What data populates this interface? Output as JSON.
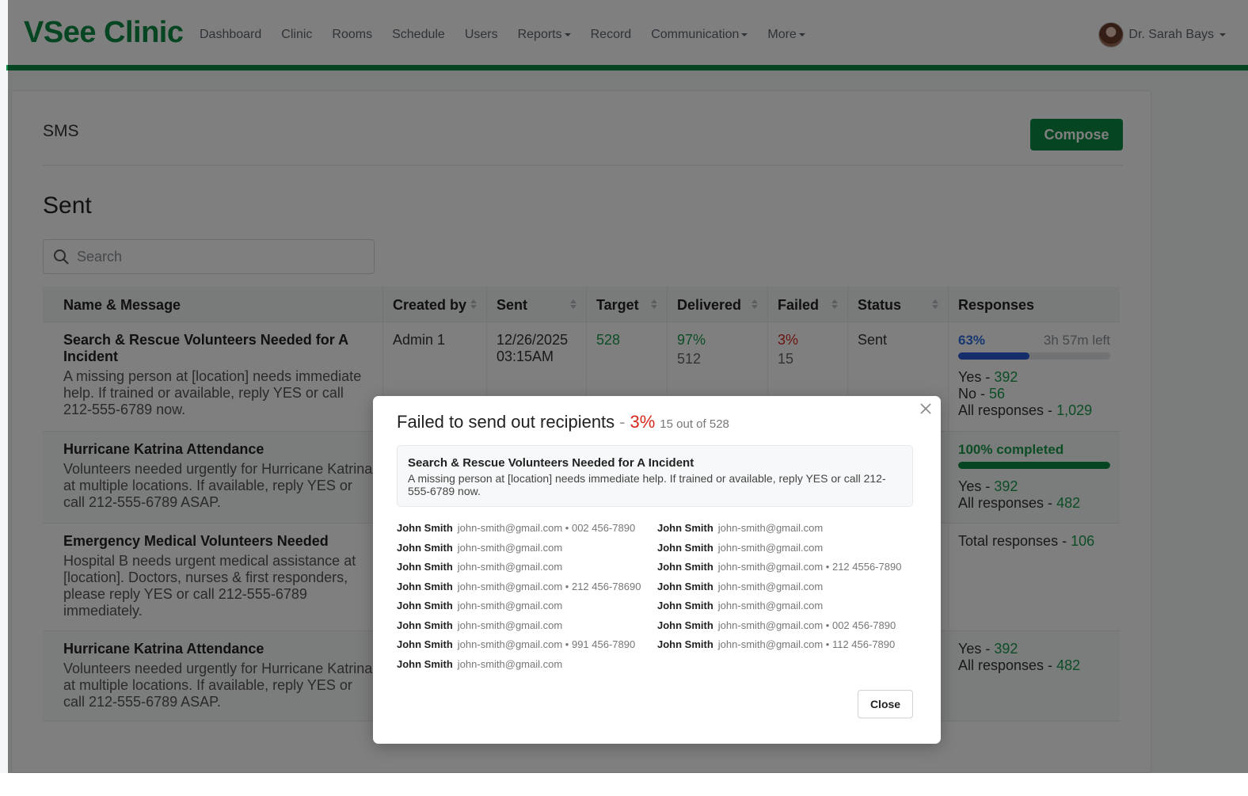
{
  "app": {
    "logo": "VSee Clinic"
  },
  "nav": {
    "items": [
      {
        "label": "Dashboard",
        "dropdown": false
      },
      {
        "label": "Clinic",
        "dropdown": false
      },
      {
        "label": "Rooms",
        "dropdown": false
      },
      {
        "label": "Schedule",
        "dropdown": false
      },
      {
        "label": "Users",
        "dropdown": false
      },
      {
        "label": "Reports",
        "dropdown": true
      },
      {
        "label": "Record",
        "dropdown": false
      },
      {
        "label": "Communication",
        "dropdown": true
      },
      {
        "label": "More",
        "dropdown": true
      }
    ],
    "user": "Dr. Sarah Bays"
  },
  "page": {
    "section_title": "SMS",
    "compose_label": "Compose",
    "list_title": "Sent",
    "search_placeholder": "Search"
  },
  "table": {
    "headers": [
      "Name & Message",
      "Created by",
      "Sent",
      "Target",
      "Delivered",
      "Failed",
      "Status",
      "Responses"
    ],
    "rows": [
      {
        "title": "Search & Rescue Volunteers Needed for A Incident",
        "body": "A missing person at [location] needs immediate help. If trained or available, reply YES or call 212-555-6789 now.",
        "created_by": "Admin 1",
        "sent_date": "12/26/2025",
        "sent_time": "03:15AM",
        "target": "528",
        "delivered_pct": "97%",
        "delivered_count": "512",
        "failed_pct": "3%",
        "failed_count": "15",
        "status": "Sent",
        "resp_pct": "63%",
        "resp_progress": 0.47,
        "resp_left": "3h 57m left",
        "yes_label": "Yes - ",
        "yes": "392",
        "no_label": "No - ",
        "no": "56",
        "all_label": "All responses - ",
        "all": "1,029"
      },
      {
        "title": "Hurricane Katrina Attendance",
        "body": "Volunteers needed urgently for Hurricane Katrina at multiple locations. If available, reply YES or call 212-555-6789 ASAP.",
        "resp_completed": "100% completed",
        "resp_progress": 1.0,
        "yes_label": "Yes - ",
        "yes": "392",
        "all_label": "All responses - ",
        "all": "482"
      },
      {
        "title": "Emergency Medical Volunteers Needed",
        "body": "Hospital B needs urgent medical assistance at [location]. Doctors, nurses & first responders, please reply YES or call 212-555-6789 immediately.",
        "total_label": "Total responses - ",
        "total": "106"
      },
      {
        "title": "Hurricane Katrina Attendance",
        "body": "Volunteers needed urgently for Hurricane Katrina at multiple locations. If available, reply YES or call 212-555-6789 ASAP.",
        "yes_label": "Yes - ",
        "yes": "392",
        "all_label": "All responses - ",
        "all": "482"
      }
    ]
  },
  "modal": {
    "title": "Failed to send out recipients",
    "dash": "-",
    "pct": "3%",
    "count": "15 out of 528",
    "message_title": "Search & Rescue Volunteers Needed for A Incident",
    "message_body": "A missing person at [location] needs immediate help. If trained or available, reply YES or call 212-555-6789 now.",
    "close_label": "Close",
    "recipients_left": [
      {
        "name": "John Smith",
        "email": "john-smith@gmail.com",
        "phone": " • 002 456-7890"
      },
      {
        "name": "John Smith",
        "email": "john-smith@gmail.com",
        "phone": ""
      },
      {
        "name": "John Smith",
        "email": "john-smith@gmail.com",
        "phone": ""
      },
      {
        "name": "John Smith",
        "email": "john-smith@gmail.com",
        "phone": " • 212 456-78690"
      },
      {
        "name": "John Smith",
        "email": "john-smith@gmail.com",
        "phone": ""
      },
      {
        "name": "John Smith",
        "email": "john-smith@gmail.com",
        "phone": ""
      },
      {
        "name": "John Smith",
        "email": "john-smith@gmail.com",
        "phone": " • 991 456-7890"
      },
      {
        "name": "John Smith",
        "email": "john-smith@gmail.com",
        "phone": ""
      }
    ],
    "recipients_right": [
      {
        "name": "John Smith",
        "email": "john-smith@gmail.com",
        "phone": ""
      },
      {
        "name": "John Smith",
        "email": "john-smith@gmail.com",
        "phone": ""
      },
      {
        "name": "John Smith",
        "email": "john-smith@gmail.com",
        "phone": " • 212 4556-7890"
      },
      {
        "name": "John Smith",
        "email": "john-smith@gmail.com",
        "phone": ""
      },
      {
        "name": "John Smith",
        "email": "john-smith@gmail.com",
        "phone": ""
      },
      {
        "name": "John Smith",
        "email": "john-smith@gmail.com",
        "phone": " • 002 456-7890"
      },
      {
        "name": "John Smith",
        "email": "john-smith@gmail.com",
        "phone": " • 112 456-7890"
      }
    ]
  },
  "colors": {
    "brand_green": "#0d8a43",
    "failed_red": "#d6281e",
    "progress_blue": "#2a5bd7",
    "value_green": "#1a9a4c"
  },
  "icons": {
    "search": "search-icon",
    "sort": "sort-icon",
    "close": "close-icon",
    "caret": "caret-down-icon"
  }
}
